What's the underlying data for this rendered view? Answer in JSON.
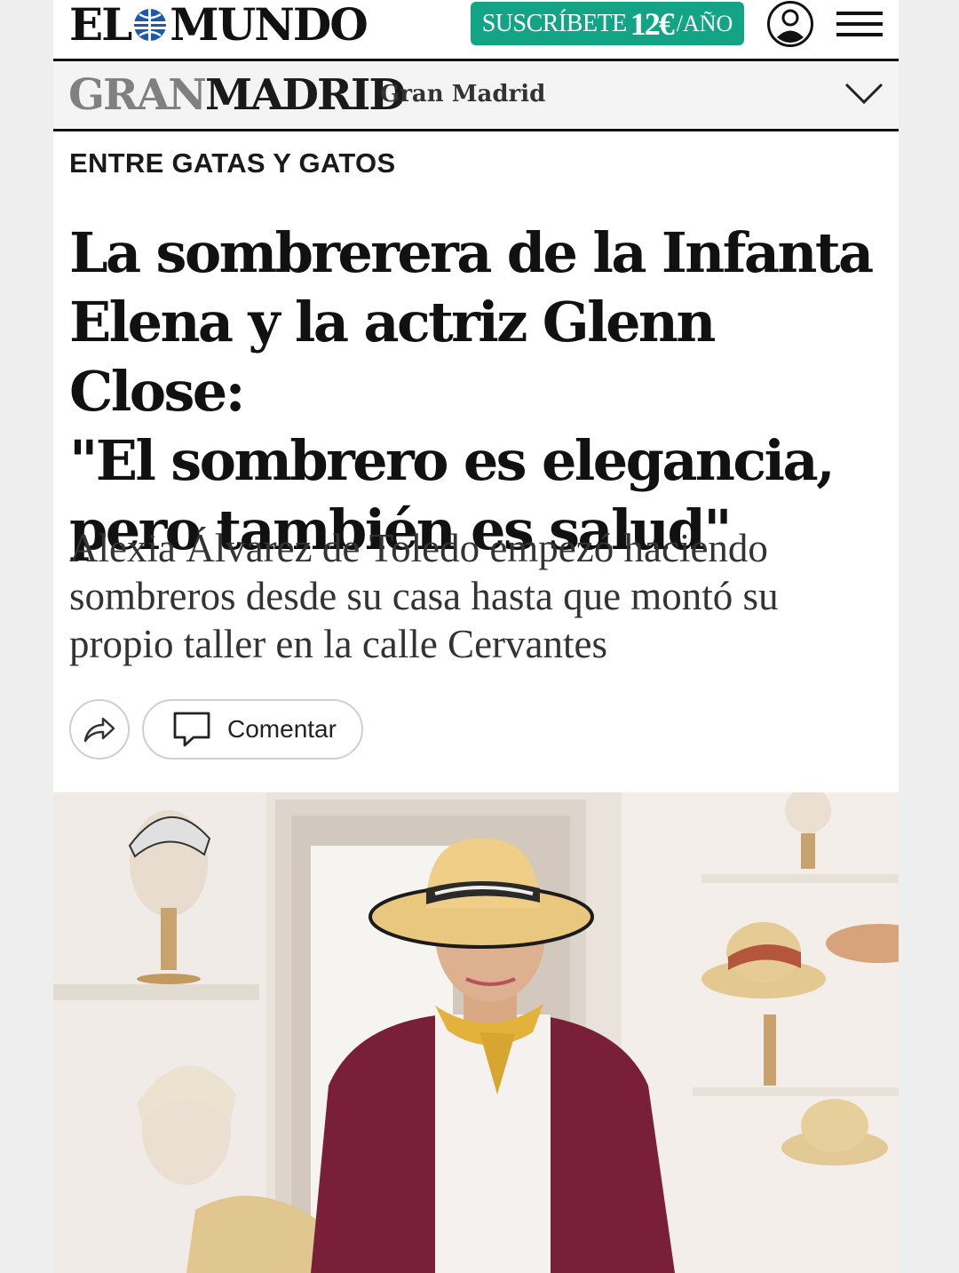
{
  "header": {
    "logo": {
      "left": "EL",
      "right": "MUNDO"
    },
    "subscribe": {
      "text": "SUSCRÍBETE",
      "price": "12€",
      "unit": "/AÑO"
    },
    "icons": {
      "account": "user-icon",
      "menu": "hamburger-menu-icon"
    }
  },
  "section": {
    "logo": {
      "gran": "GRAN",
      "madrid": "MADRID"
    },
    "name": "Gran Madrid",
    "icon": "chevron-down-icon"
  },
  "article": {
    "kicker": "ENTRE GATAS Y GATOS",
    "headline_lines": [
      "La sombrerera de la Infanta",
      "Elena y la actriz Glenn Close:",
      "\"El sombrero es elegancia,",
      "pero también es salud\""
    ],
    "subhead_lines": [
      "Alexia Álvarez de Toledo empezó haciendo",
      "sombreros desde su casa hasta que montó su",
      "propio taller en la calle Cervantes"
    ],
    "actions": {
      "share_icon": "share-arrow-icon",
      "comment_icon": "speech-bubble-icon",
      "comment_label": "Comentar"
    }
  },
  "colors": {
    "brand_green": "#12a485",
    "text_dark": "#111111",
    "section_gray": "#808080",
    "page_bg": "#eeeeee"
  }
}
